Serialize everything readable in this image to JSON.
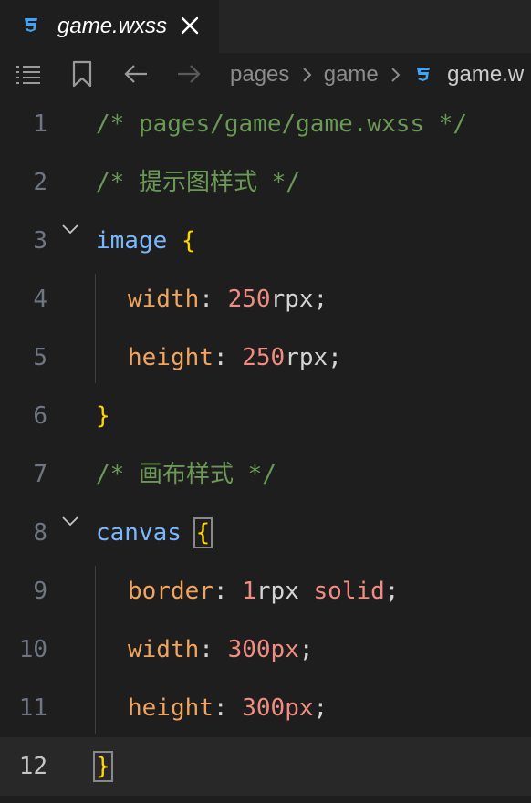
{
  "tab": {
    "title": "game.wxss",
    "file_icon": "css3-icon",
    "close_icon": "close-icon"
  },
  "breadcrumb": {
    "items": [
      "pages",
      "game"
    ],
    "file": "game.w"
  },
  "toolbar_icons": [
    "list-icon",
    "bookmark-icon",
    "arrow-left-icon",
    "arrow-right-icon"
  ],
  "colors": {
    "comment": "#6a9955",
    "selector": "#79b8ff",
    "brace": "#ffd700",
    "property": "#f0a45d",
    "number": "#f28b82",
    "css_icon": "#42a5f5"
  },
  "editor": {
    "current_line": 12,
    "lines": [
      {
        "n": "1",
        "tokens": [
          {
            "t": "/* pages/game/game.wxss */",
            "c": "comment"
          }
        ]
      },
      {
        "n": "2",
        "tokens": [
          {
            "t": "/* 提示图样式 */",
            "c": "comment"
          }
        ]
      },
      {
        "n": "3",
        "tokens": [
          {
            "t": "image",
            "c": "selector"
          },
          {
            "t": " ",
            "c": "punct"
          },
          {
            "t": "{",
            "c": "brace"
          }
        ]
      },
      {
        "n": "4",
        "tokens": [
          {
            "t": "width",
            "c": "property"
          },
          {
            "t": ": ",
            "c": "punct"
          },
          {
            "t": "250",
            "c": "number"
          },
          {
            "t": "rpx",
            "c": "unit"
          },
          {
            "t": ";",
            "c": "punct"
          }
        ]
      },
      {
        "n": "5",
        "tokens": [
          {
            "t": "height",
            "c": "property"
          },
          {
            "t": ": ",
            "c": "punct"
          },
          {
            "t": "250",
            "c": "number"
          },
          {
            "t": "rpx",
            "c": "unit"
          },
          {
            "t": ";",
            "c": "punct"
          }
        ]
      },
      {
        "n": "6",
        "tokens": [
          {
            "t": "}",
            "c": "brace"
          }
        ]
      },
      {
        "n": "7",
        "tokens": [
          {
            "t": "/* 画布样式 */",
            "c": "comment"
          }
        ]
      },
      {
        "n": "8",
        "tokens": [
          {
            "t": "canvas",
            "c": "selector"
          },
          {
            "t": " ",
            "c": "punct"
          },
          {
            "t": "{",
            "c": "brace"
          }
        ]
      },
      {
        "n": "9",
        "tokens": [
          {
            "t": "border",
            "c": "property"
          },
          {
            "t": ": ",
            "c": "punct"
          },
          {
            "t": "1",
            "c": "number"
          },
          {
            "t": "rpx",
            "c": "unit"
          },
          {
            "t": " ",
            "c": "punct"
          },
          {
            "t": "solid",
            "c": "value"
          },
          {
            "t": ";",
            "c": "punct"
          }
        ]
      },
      {
        "n": "10",
        "tokens": [
          {
            "t": "width",
            "c": "property"
          },
          {
            "t": ": ",
            "c": "punct"
          },
          {
            "t": "300px",
            "c": "number"
          },
          {
            "t": ";",
            "c": "punct"
          }
        ]
      },
      {
        "n": "11",
        "tokens": [
          {
            "t": "height",
            "c": "property"
          },
          {
            "t": ": ",
            "c": "punct"
          },
          {
            "t": "300px",
            "c": "number"
          },
          {
            "t": ";",
            "c": "punct"
          }
        ]
      },
      {
        "n": "12",
        "tokens": [
          {
            "t": "}",
            "c": "brace"
          }
        ]
      }
    ]
  }
}
